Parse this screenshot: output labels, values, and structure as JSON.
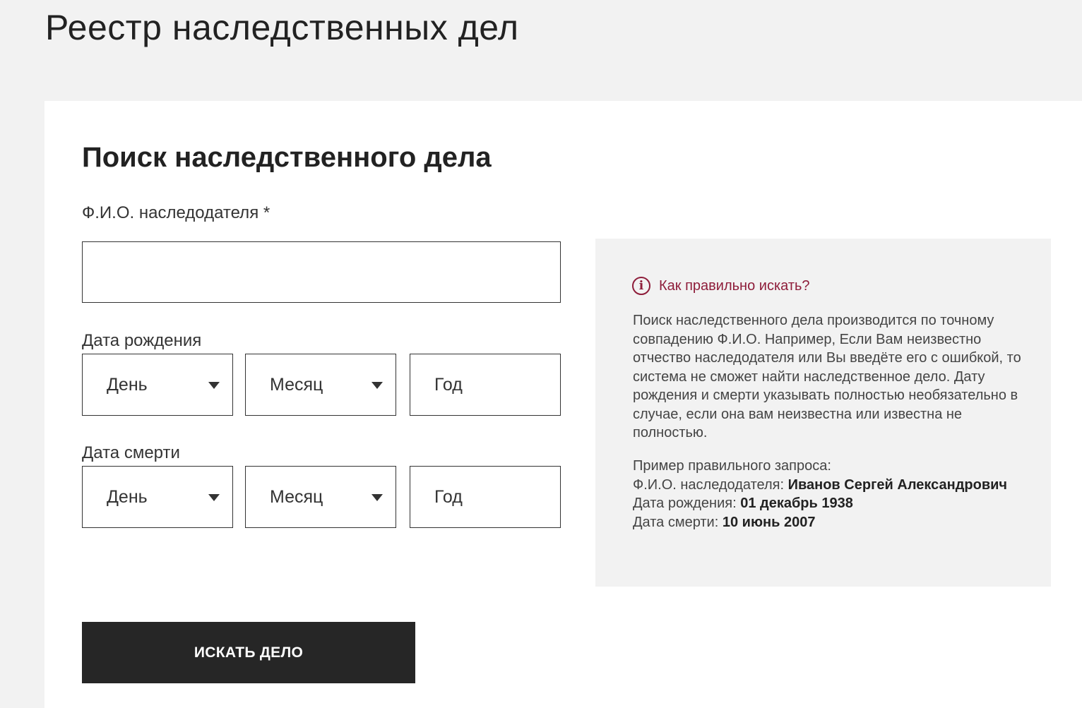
{
  "page": {
    "title": "Реестр наследственных дел"
  },
  "form": {
    "title": "Поиск наследственного дела",
    "fio_label": "Ф.И.О. наследодателя *",
    "fio_value": "",
    "birth_label": "Дата рождения",
    "death_label": "Дата смерти",
    "day_label": "День",
    "month_label": "Месяц",
    "year_placeholder": "Год",
    "submit_label": "ИСКАТЬ ДЕЛО"
  },
  "hint": {
    "icon": "info-icon",
    "title": "Как правильно искать?",
    "body": "Поиск наследственного дела производится по точному совпадению Ф.И.О. Например, Если Вам неизвестно отчество наследодателя или Вы введёте его с ошибкой, то система не сможет найти наследственное дело. Дату рождения и смерти указывать полностью необязательно в случае, если она вам неизвестна или известна не полностью.",
    "example_title": "Пример правильного запроса:",
    "example_fio_label": "Ф.И.О. наследодателя: ",
    "example_fio_value": "Иванов Сергей Александрович",
    "example_birth_label": "Дата рождения: ",
    "example_birth_value": "01 декабрь 1938",
    "example_death_label": "Дата смерти: ",
    "example_death_value": "10 июнь 2007"
  },
  "colors": {
    "accent": "#8e1d3a",
    "button_bg": "#262626",
    "page_bg": "#f2f2f2"
  }
}
